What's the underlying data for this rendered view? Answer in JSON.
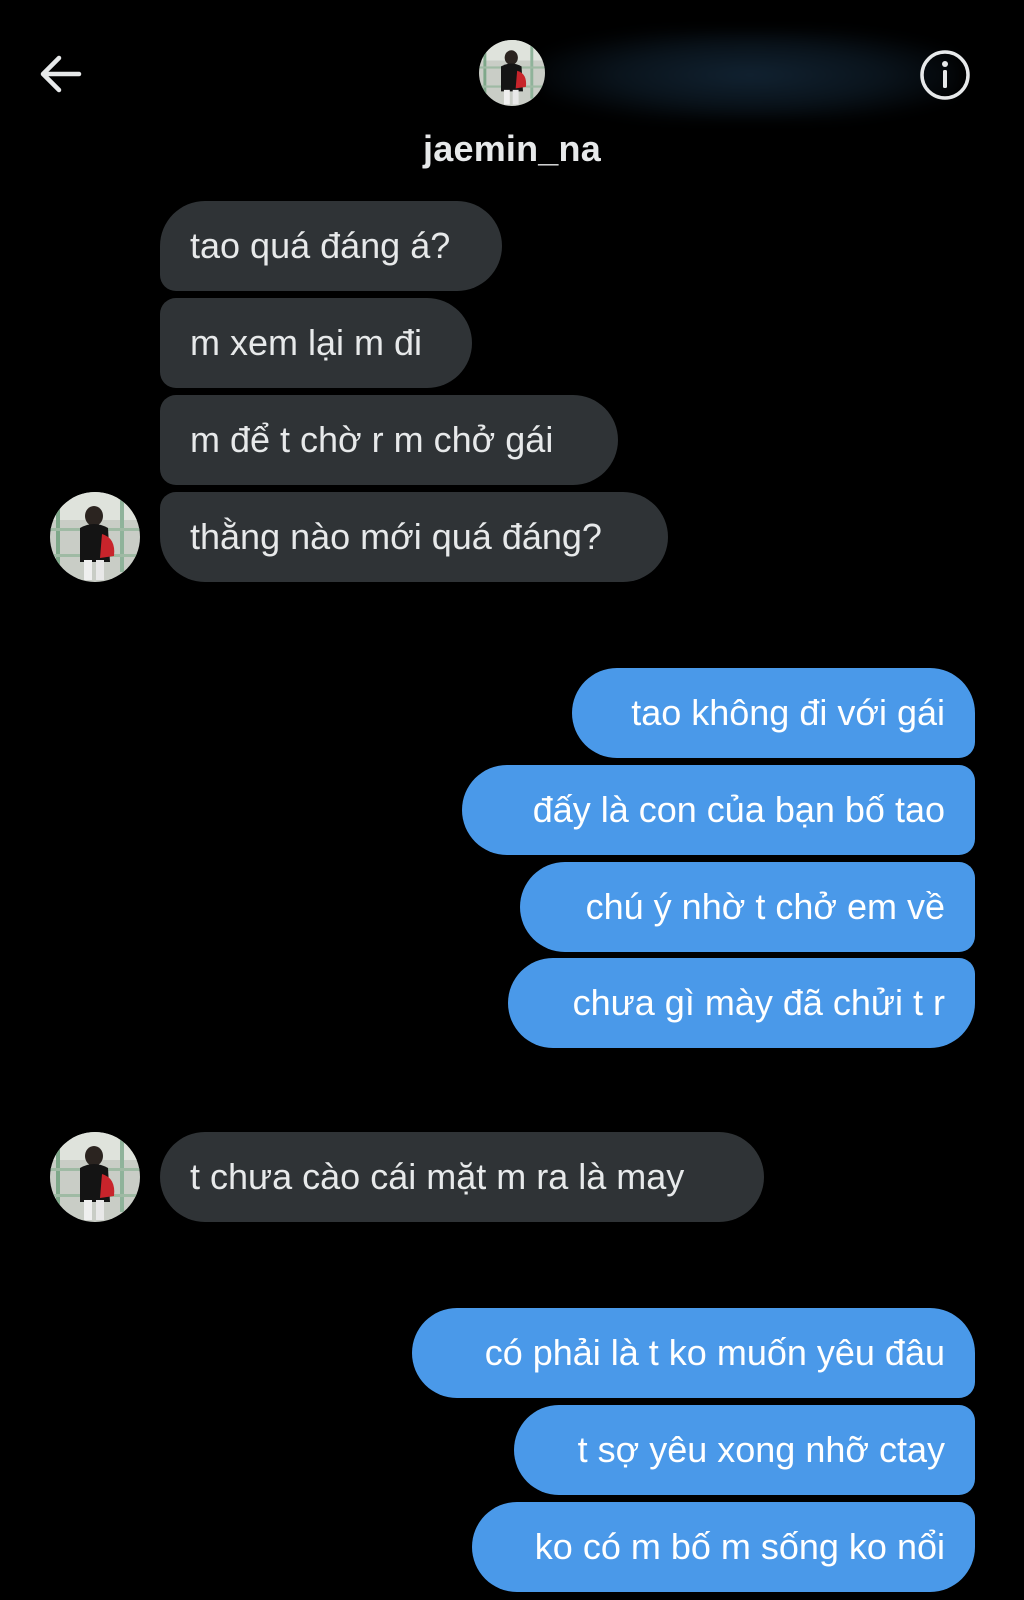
{
  "header": {
    "username": "jaemin_na",
    "back_icon": "arrow-left-icon",
    "info_icon": "info-circle-icon"
  },
  "messages": {
    "group1": [
      "tao quá đáng á?",
      "m xem lại m đi",
      "m để t chờ r m chở gái",
      "thằng nào mới quá đáng?"
    ],
    "group2": [
      "tao không đi với gái",
      "đấy là con của bạn bố tao",
      "chú ý nhờ t chở em về",
      "chưa gì mày đã chửi t r"
    ],
    "group3": [
      "t chưa cào cái mặt m ra là may"
    ],
    "group4": [
      "có phải là t ko muốn yêu đâu",
      "t sợ yêu xong nhỡ ctay",
      "ko có m bố m sống ko nổi"
    ]
  },
  "colors": {
    "background": "#000000",
    "incoming_bubble": "#2f3336",
    "outgoing_bubble": "#4a99e9",
    "text": "#e7e9ea"
  }
}
